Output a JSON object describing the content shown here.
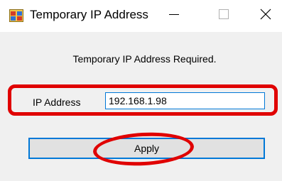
{
  "window": {
    "title": "Temporary IP Address",
    "app_icon": "window-app-icon",
    "controls": {
      "minimize_icon": "minimize-icon",
      "maximize_icon": "maximize-icon",
      "close_icon": "close-icon"
    }
  },
  "dialog": {
    "prompt": "Temporary IP Address Required.",
    "ip_label": "IP Address",
    "ip_value": "192.168.1.98",
    "apply_label": "Apply"
  },
  "annotations": {
    "highlight_color": "#e00000"
  },
  "colors": {
    "accent": "#0078d7",
    "button_face": "#e1e1e1",
    "window_bg": "#f0f0f0"
  }
}
